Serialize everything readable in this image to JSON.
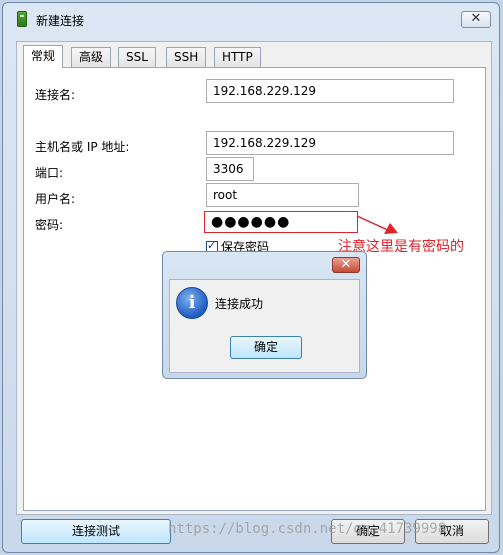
{
  "window": {
    "title": "新建连接",
    "close": "✕"
  },
  "tabs": [
    "常规",
    "高级",
    "SSL",
    "SSH",
    "HTTP"
  ],
  "form": {
    "conn_name_label": "连接名:",
    "conn_name_value": "192.168.229.129",
    "host_label": "主机名或 IP 地址:",
    "host_value": "192.168.229.129",
    "port_label": "端口:",
    "port_value": "3306",
    "user_label": "用户名:",
    "user_value": "root",
    "password_label": "密码:",
    "password_value": "●●●●●●",
    "save_password_label": "保存密码",
    "save_password_checked": true
  },
  "annotation": "注意这里是有密码的",
  "message_box": {
    "close": "✕",
    "icon": "info-icon",
    "text": "连接成功",
    "ok_label": "确定"
  },
  "footer": {
    "test_label": "连接测试",
    "ok_label": "确定",
    "cancel_label": "取消"
  },
  "watermark": "https://blog.csdn.net/qq_41739998"
}
